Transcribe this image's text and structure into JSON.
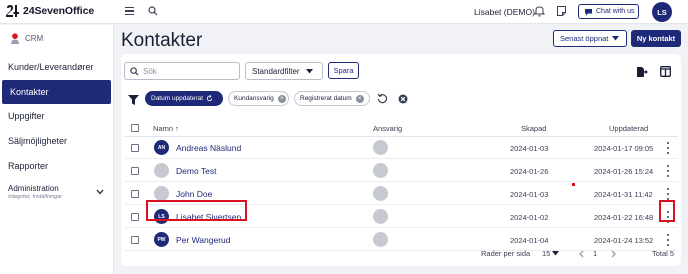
{
  "app": {
    "logo": "24SevenOffice"
  },
  "topbar": {
    "user": "Lisabet (DEMO)",
    "chat_label": "Chat with us",
    "avatar_initials": "LS"
  },
  "sidebar": {
    "module": "CRM",
    "items": [
      {
        "label": "Kunder/Leverandører",
        "active": false
      },
      {
        "label": "Kontakter",
        "active": true
      },
      {
        "label": "Uppgifter",
        "active": false
      },
      {
        "label": "Säljmöjligheter",
        "active": false
      },
      {
        "label": "Rapporter",
        "active": false
      }
    ],
    "admin": {
      "title": "Administration",
      "subtitle": "Integritet, Inställningar"
    }
  },
  "header": {
    "title": "Kontakter",
    "recent_label": "Senast öppnat",
    "new_label": "Ny kontakt"
  },
  "toolbar": {
    "search_placeholder": "Sök",
    "filter_select": "Standardfilter",
    "save_label": "Spara"
  },
  "filters": {
    "active_chip": "Datum uppdaterat",
    "chips": [
      "Kundansvarig",
      "Registrerat datum"
    ]
  },
  "table": {
    "columns": {
      "name": "Namn ↑",
      "responsible": "Ansvarig",
      "created": "Skapad",
      "updated": "Uppdaterad"
    },
    "rows": [
      {
        "initials": "AN",
        "name": "Andreas Näslund",
        "created": "2024-01-03",
        "updated": "2024-01-17 09:05",
        "has_avatar": true
      },
      {
        "initials": "",
        "name": "Demo Test",
        "created": "2024-01-26",
        "updated": "2024-01-26 15:24",
        "has_avatar": false
      },
      {
        "initials": "",
        "name": "John Doe",
        "created": "2024-01-03",
        "updated": "2024-01-31 11:42",
        "has_avatar": false
      },
      {
        "initials": "LS",
        "name": "Lisabet Sivertsen",
        "created": "2024-01-02",
        "updated": "2024-01-22 16:48",
        "has_avatar": true
      },
      {
        "initials": "PW",
        "name": "Per Wangerud",
        "created": "2024-01-04",
        "updated": "2024-01-24 13:52",
        "has_avatar": true
      }
    ]
  },
  "pagination": {
    "rows_label": "Rader per sida",
    "rows_value": "15",
    "page": "1",
    "total": "Total 5"
  },
  "colors": {
    "brand": "#1e2a78",
    "highlight": "#d8121f"
  }
}
